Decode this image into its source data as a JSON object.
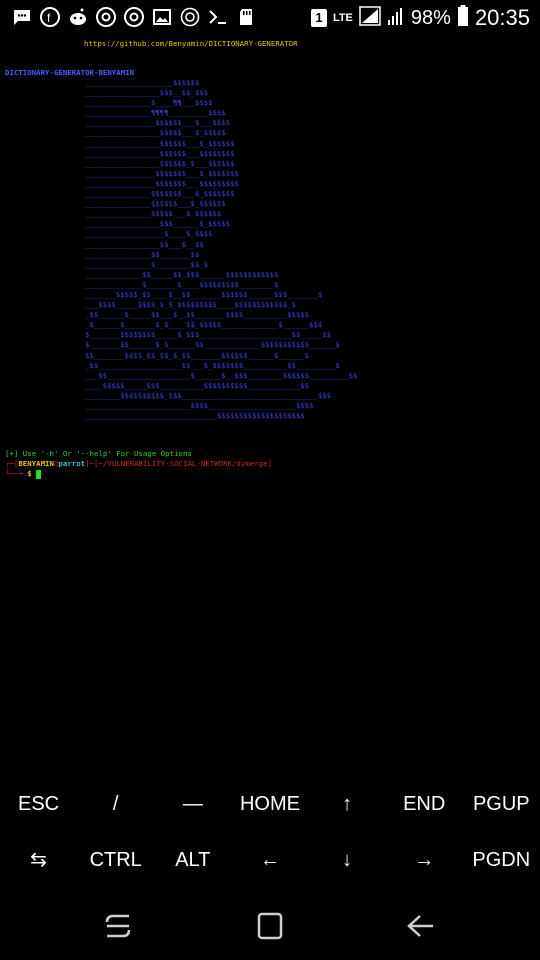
{
  "status_bar": {
    "left_icons": [
      "message-icon",
      "facebook-icon",
      "reddit-icon",
      "chrome-icon",
      "chrome-icon",
      "image-icon",
      "target-icon",
      "terminal-icon",
      "sd-card-icon"
    ],
    "sim_badge": "1",
    "network": "LTE",
    "battery": "98%",
    "time": "20:35"
  },
  "terminal": {
    "url": "https://github.com/Benyamin/DICTIONARY-GENERATOR",
    "title": "DICTIONARY-GENERATOR-BENYAMIN",
    "ascii_art": "____________________$$$$$$\n_________________$$$__$$_$$$\n_______________$____¶¶___$$$$\n_______________¶¶¶¶_________$$$$\n________________$$$$$$___$___$$$$\n_________________$$$$$___$_$$$$$\n_________________$$$$$$___$_$$$$$$\n_________________$$$$$$___$$$$$$$$\n_________________$$$$$$_$___$$$$$$\n________________$$$$$$$___$_$$$$$$$\n________________$$$$$$$___$$$$$$$$$\n_______________$$$$$$$___$_$$$$$$$\n_______________$$$$$$___$_$$$$$$\n_______________$$$$$___$_$$$$$$\n_________________$$$______$_$$$$$\n__________________$____$_$$$$\n_________________$$___$__$$\n_______________$$_______$$\n_______________$________$$_$\n_____________$$_____$$_$$$______$$$$$$$$$$$$\n_____________$_______$____$$$$$$$$$________$\n_______$$$$$_$$____$__$$_______$$$$$$______$$$_______$\n___$$$$_____$$$$_$_$_$$$$$$$$$____$$$$$$$$$$$$_$\n_$$______$_____$$___$__$$_______$$$$__________$$$$$\n_$______$_______$_$____$$_$$$$$_____________$______$$$\n$_______$$$$$$$$_____$_$$$_____________________$$_____$$\n$_______$$______$_$______$$_____________$$$$$$$$$$$______$\n$$_______$$$$_$$_$$_$_$$_______$$$$$$______$______$\n_$$___________________$$___$_$$$$$$$__________$$_________$\n___$$___________________$______$__$$$________$$$$$$_________$$\n____$$$$$_____$$$__________$$$$$$$$$$____________$$\n________$$$$$$$$$$_$$$_______________________________$$$\n________________________$$$$____________________$$$$\n______________________________$$$$$$$$$$$$$$$$$$$$",
    "help_text": "[+] Use '-h' Or '--help' For Usage Options",
    "prompt_user": "BENYAMIN",
    "prompt_at": "@",
    "prompt_host": "parrot",
    "prompt_path": "~/VULNERABILITY-SOCIAL-NETWORK/dymerge",
    "prompt_symbol": "$"
  },
  "extra_keys": {
    "row1": [
      "ESC",
      "/",
      "—",
      "HOME",
      "↑",
      "END",
      "PGUP"
    ],
    "row2": [
      "⇆",
      "CTRL",
      "ALT",
      "←",
      "↓",
      "→",
      "PGDN"
    ]
  },
  "nav_bar": [
    "recents-button",
    "home-button",
    "back-button"
  ]
}
